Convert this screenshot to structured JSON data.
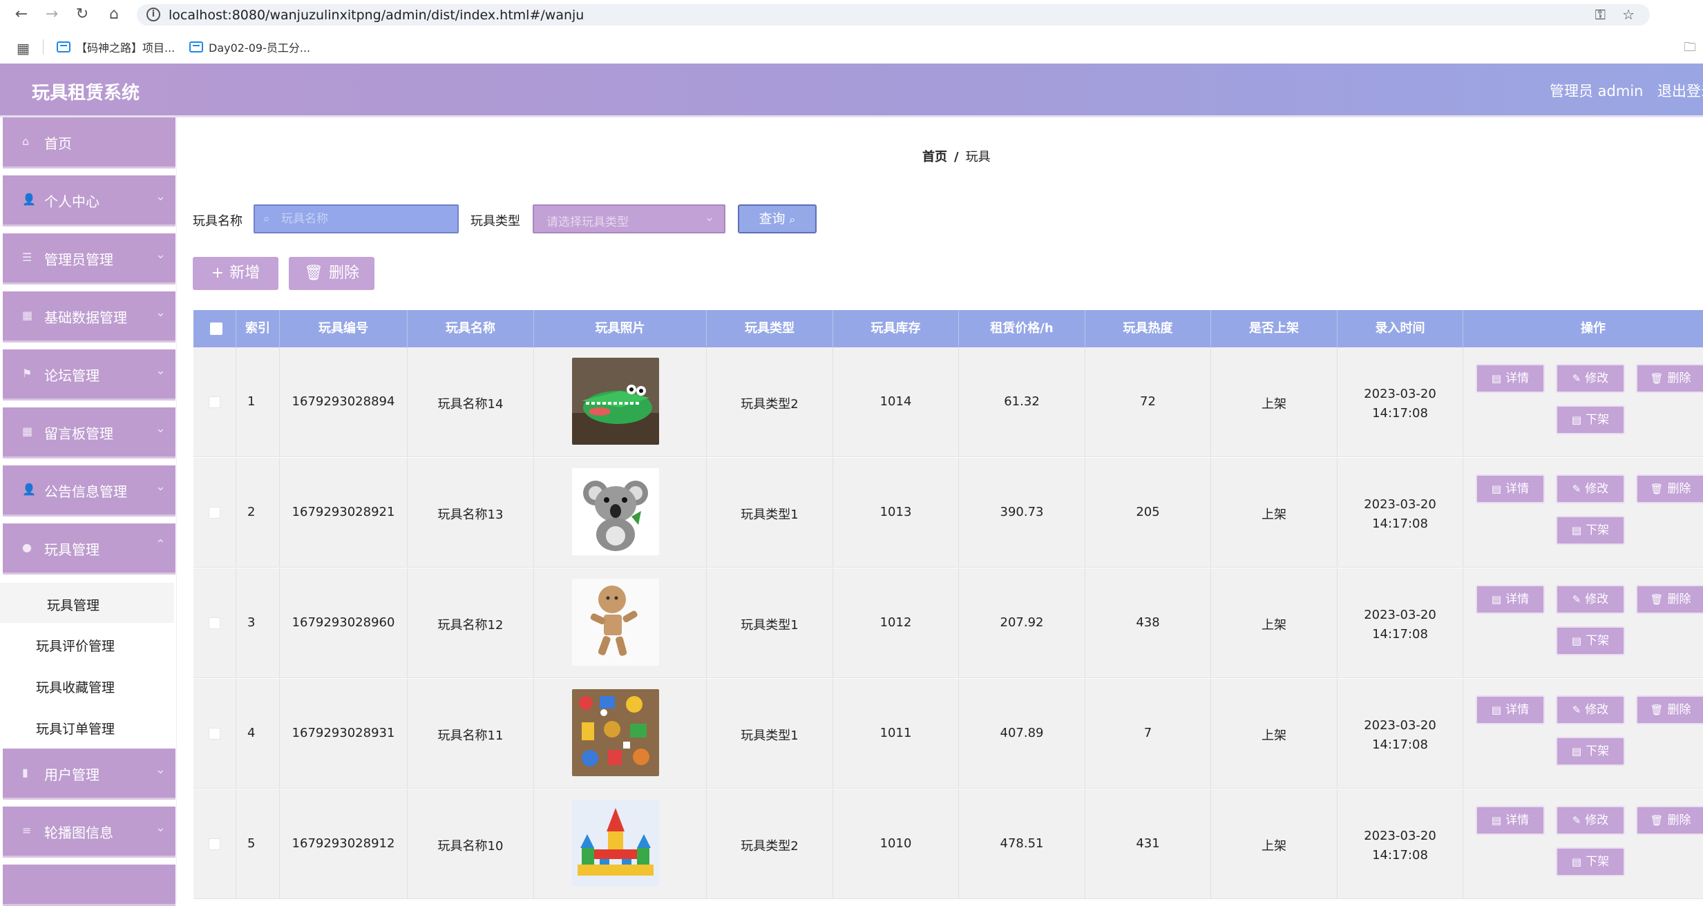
{
  "browser": {
    "url": "localhost:8080/wanjuzulinxitpng/admin/dist/index.html#/wanju",
    "bookmarks": [
      "【码神之路】项目...",
      "Day02-09-员工分..."
    ]
  },
  "app": {
    "title": "玩具租赁系统",
    "user": "管理员 admin",
    "logout": "退出登录"
  },
  "sidebar": {
    "items": [
      {
        "label": "首页",
        "icon": "home-icon"
      },
      {
        "label": "个人中心",
        "icon": "user-icon"
      },
      {
        "label": "管理员管理",
        "icon": "list-icon"
      },
      {
        "label": "基础数据管理",
        "icon": "grid-icon"
      },
      {
        "label": "论坛管理",
        "icon": "flag-icon"
      },
      {
        "label": "留言板管理",
        "icon": "grid-icon"
      },
      {
        "label": "公告信息管理",
        "icon": "user-icon"
      },
      {
        "label": "玩具管理",
        "icon": "location-icon"
      },
      {
        "label": "用户管理",
        "icon": "bar-chart-icon"
      },
      {
        "label": "轮播图信息",
        "icon": "menu-icon"
      }
    ],
    "subitems": [
      "玩具管理",
      "玩具评价管理",
      "玩具收藏管理",
      "玩具订单管理"
    ]
  },
  "breadcrumb": {
    "home": "首页",
    "sep": "/",
    "current": "玩具"
  },
  "search": {
    "name_label": "玩具名称",
    "name_placeholder": "玩具名称",
    "type_label": "玩具类型",
    "type_placeholder": "请选择玩具类型",
    "query_label": "查询"
  },
  "actions": {
    "add": "新增",
    "delete": "删除"
  },
  "table": {
    "columns": [
      "索引",
      "玩具编号",
      "玩具名称",
      "玩具照片",
      "玩具类型",
      "玩具库存",
      "租赁价格/h",
      "玩具热度",
      "是否上架",
      "录入时间",
      "操作"
    ],
    "rows": [
      {
        "index": "1",
        "code": "1679293028894",
        "name": "玩具名称14",
        "photo": "green-crocodile-toy",
        "type": "玩具类型2",
        "stock": "1014",
        "price": "61.32",
        "heat": "72",
        "shelf": "上架",
        "time": "2023-03-20 14:17:08"
      },
      {
        "index": "2",
        "code": "1679293028921",
        "name": "玩具名称13",
        "photo": "koala-plush-toy",
        "type": "玩具类型1",
        "stock": "1013",
        "price": "390.73",
        "heat": "205",
        "shelf": "上架",
        "time": "2023-03-20 14:17:08"
      },
      {
        "index": "3",
        "code": "1679293028960",
        "name": "玩具名称12",
        "photo": "wooden-figure-toy",
        "type": "玩具类型1",
        "stock": "1012",
        "price": "207.92",
        "heat": "438",
        "shelf": "上架",
        "time": "2023-03-20 14:17:08"
      },
      {
        "index": "4",
        "code": "1679293028931",
        "name": "玩具名称11",
        "photo": "assorted-toys",
        "type": "玩具类型1",
        "stock": "1011",
        "price": "407.89",
        "heat": "7",
        "shelf": "上架",
        "time": "2023-03-20 14:17:08"
      },
      {
        "index": "5",
        "code": "1679293028912",
        "name": "玩具名称10",
        "photo": "building-blocks-castle",
        "type": "玩具类型2",
        "stock": "1010",
        "price": "478.51",
        "heat": "431",
        "shelf": "上架",
        "time": "2023-03-20 14:17:08"
      }
    ],
    "ops": {
      "detail": "详情",
      "edit": "修改",
      "delete": "删除",
      "offshelf": "下架"
    }
  },
  "colors": {
    "header_gradient_start": "#b99ad0",
    "header_gradient_end": "#9aa6e4",
    "sidebar_item": "#be9ccf",
    "table_header": "#95a7e6",
    "button": "#c4a3d7"
  }
}
